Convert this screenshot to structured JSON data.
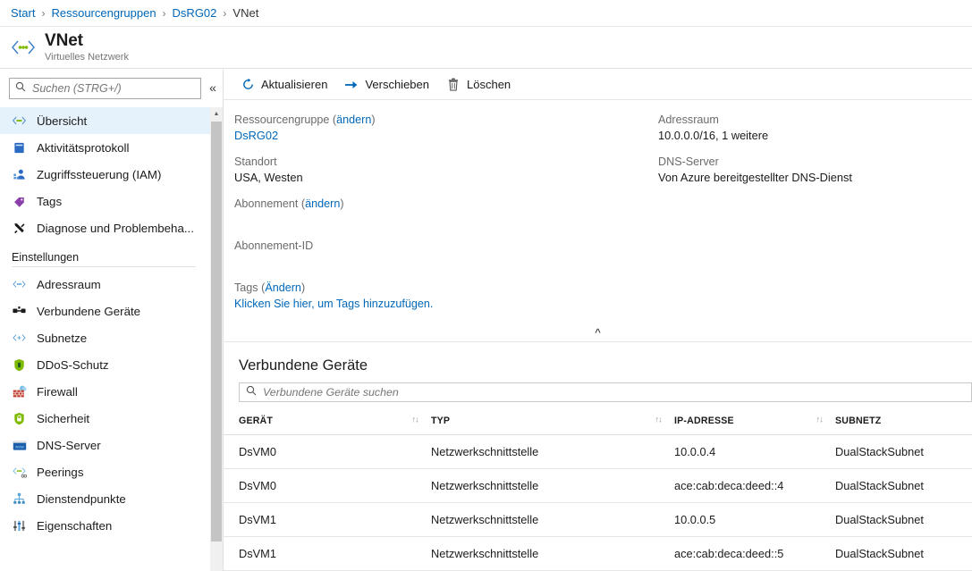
{
  "breadcrumb": [
    {
      "label": "Start",
      "current": false
    },
    {
      "label": "Ressourcengruppen",
      "current": false
    },
    {
      "label": "DsRG02",
      "current": false
    },
    {
      "label": "VNet",
      "current": true
    }
  ],
  "header": {
    "title": "VNet",
    "subtitle": "Virtuelles Netzwerk",
    "icon": "virtual-network-icon"
  },
  "sidebar": {
    "search": {
      "placeholder": "Suchen (STRG+/)",
      "value": "",
      "icon": "search-icon"
    },
    "collapse_icon": "chevron-double-left-icon",
    "items": [
      {
        "label": "Übersicht",
        "icon": "virtual-network-icon",
        "selected": true
      },
      {
        "label": "Aktivitätsprotokoll",
        "icon": "activity-log-icon",
        "selected": false
      },
      {
        "label": "Zugriffssteuerung (IAM)",
        "icon": "access-control-icon",
        "selected": false
      },
      {
        "label": "Tags",
        "icon": "tag-icon",
        "selected": false
      },
      {
        "label": "Diagnose und Problembeha...",
        "icon": "troubleshoot-icon",
        "selected": false
      }
    ],
    "group_label": "Einstellungen",
    "settings_items": [
      {
        "label": "Adressraum",
        "icon": "address-space-icon"
      },
      {
        "label": "Verbundene Geräte",
        "icon": "connected-devices-icon"
      },
      {
        "label": "Subnetze",
        "icon": "subnet-icon"
      },
      {
        "label": "DDoS-Schutz",
        "icon": "ddos-shield-icon"
      },
      {
        "label": "Firewall",
        "icon": "firewall-icon"
      },
      {
        "label": "Sicherheit",
        "icon": "security-shield-icon"
      },
      {
        "label": "DNS-Server",
        "icon": "dns-server-icon"
      },
      {
        "label": "Peerings",
        "icon": "peerings-icon"
      },
      {
        "label": "Dienstendpunkte",
        "icon": "service-endpoints-icon"
      },
      {
        "label": "Eigenschaften",
        "icon": "properties-icon"
      }
    ]
  },
  "toolbar": {
    "refresh_label": "Aktualisieren",
    "refresh_icon": "refresh-icon",
    "move_label": "Verschieben",
    "move_icon": "arrow-right-icon",
    "delete_label": "Löschen",
    "delete_icon": "trash-icon"
  },
  "properties": {
    "collapse_icon": "chevron-double-up-icon",
    "resource_group": {
      "label": "Ressourcengruppe",
      "change_link": "ändern",
      "value": "DsRG02"
    },
    "location": {
      "label": "Standort",
      "value": "USA, Westen"
    },
    "subscription": {
      "label": "Abonnement",
      "change_link": "ändern",
      "value": ""
    },
    "subscription_id": {
      "label": "Abonnement-ID",
      "value": ""
    },
    "tags": {
      "label": "Tags",
      "change_link": "Ändern",
      "add_text": "Klicken Sie hier, um Tags hinzuzufügen."
    },
    "address_space": {
      "label": "Adressraum",
      "value": "10.0.0.0/16, 1 weitere"
    },
    "dns_servers": {
      "label": "DNS-Server",
      "value": "Von Azure bereitgestellter DNS-Dienst"
    }
  },
  "devices": {
    "title": "Verbundene Geräte",
    "search": {
      "placeholder": "Verbundene Geräte suchen",
      "value": "",
      "icon": "search-icon"
    },
    "columns": [
      {
        "label": "GERÄT",
        "sortable": true,
        "sort_icon": "sort-icon"
      },
      {
        "label": "TYP",
        "sortable": true,
        "sort_icon": "sort-icon"
      },
      {
        "label": "IP-ADRESSE",
        "sortable": true,
        "sort_icon": "sort-icon"
      },
      {
        "label": "SUBNETZ",
        "sortable": false
      }
    ],
    "rows": [
      {
        "device": "DsVM0",
        "type": "Netzwerkschnittstelle",
        "ip": "10.0.0.4",
        "subnet": "DualStackSubnet"
      },
      {
        "device": "DsVM0",
        "type": "Netzwerkschnittstelle",
        "ip": "ace:cab:deca:deed::4",
        "subnet": "DualStackSubnet"
      },
      {
        "device": "DsVM1",
        "type": "Netzwerkschnittstelle",
        "ip": "10.0.0.5",
        "subnet": "DualStackSubnet"
      },
      {
        "device": "DsVM1",
        "type": "Netzwerkschnittstelle",
        "ip": "ace:cab:deca:deed::5",
        "subnet": "DualStackSubnet"
      }
    ]
  },
  "colors": {
    "link": "#0067b8",
    "selected_nav": "#e5f1fb",
    "border": "#e0e0e0",
    "muted_text": "#6b6b6b"
  }
}
